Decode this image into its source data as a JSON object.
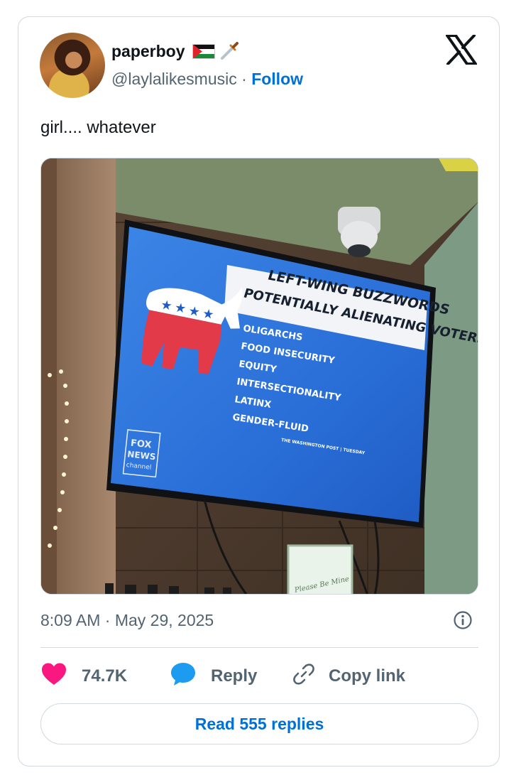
{
  "tweet": {
    "display_name": "paperboy",
    "handle": "@laylalikesmusic",
    "separator": "·",
    "follow_label": "Follow",
    "text": "girl.... whatever",
    "timestamp": "8:09 AM · May 29, 2025",
    "likes": "74.7K",
    "reply_label": "Reply",
    "copy_link_label": "Copy link",
    "read_replies_label": "Read 555 replies"
  },
  "photo": {
    "tv_title_line1": "LEFT-WING BUZZWORDS",
    "tv_title_line2": "POTENTIALLY ALIENATING VOTERS",
    "bullets": [
      "OLIGARCHS",
      "FOOD INSECURITY",
      "EQUITY",
      "INTERSECTIONALITY",
      "LATINX",
      "GENDER-FLUID"
    ],
    "source_caption": "THE WASHINGTON POST | TUESDAY",
    "network_logo_line1": "FOX",
    "network_logo_line2": "NEWS",
    "network_logo_line3": "channel",
    "sign_text": "Please Be Mine"
  },
  "colors": {
    "follow_blue": "#006fd6",
    "heart_pink": "#f91880",
    "reply_blue": "#1d9bf0",
    "muted_text": "#536471"
  },
  "icons": [
    "palestine-flag-icon",
    "dagger-icon",
    "x-logo-icon",
    "info-icon",
    "heart-icon",
    "reply-bubble-icon",
    "link-icon"
  ]
}
